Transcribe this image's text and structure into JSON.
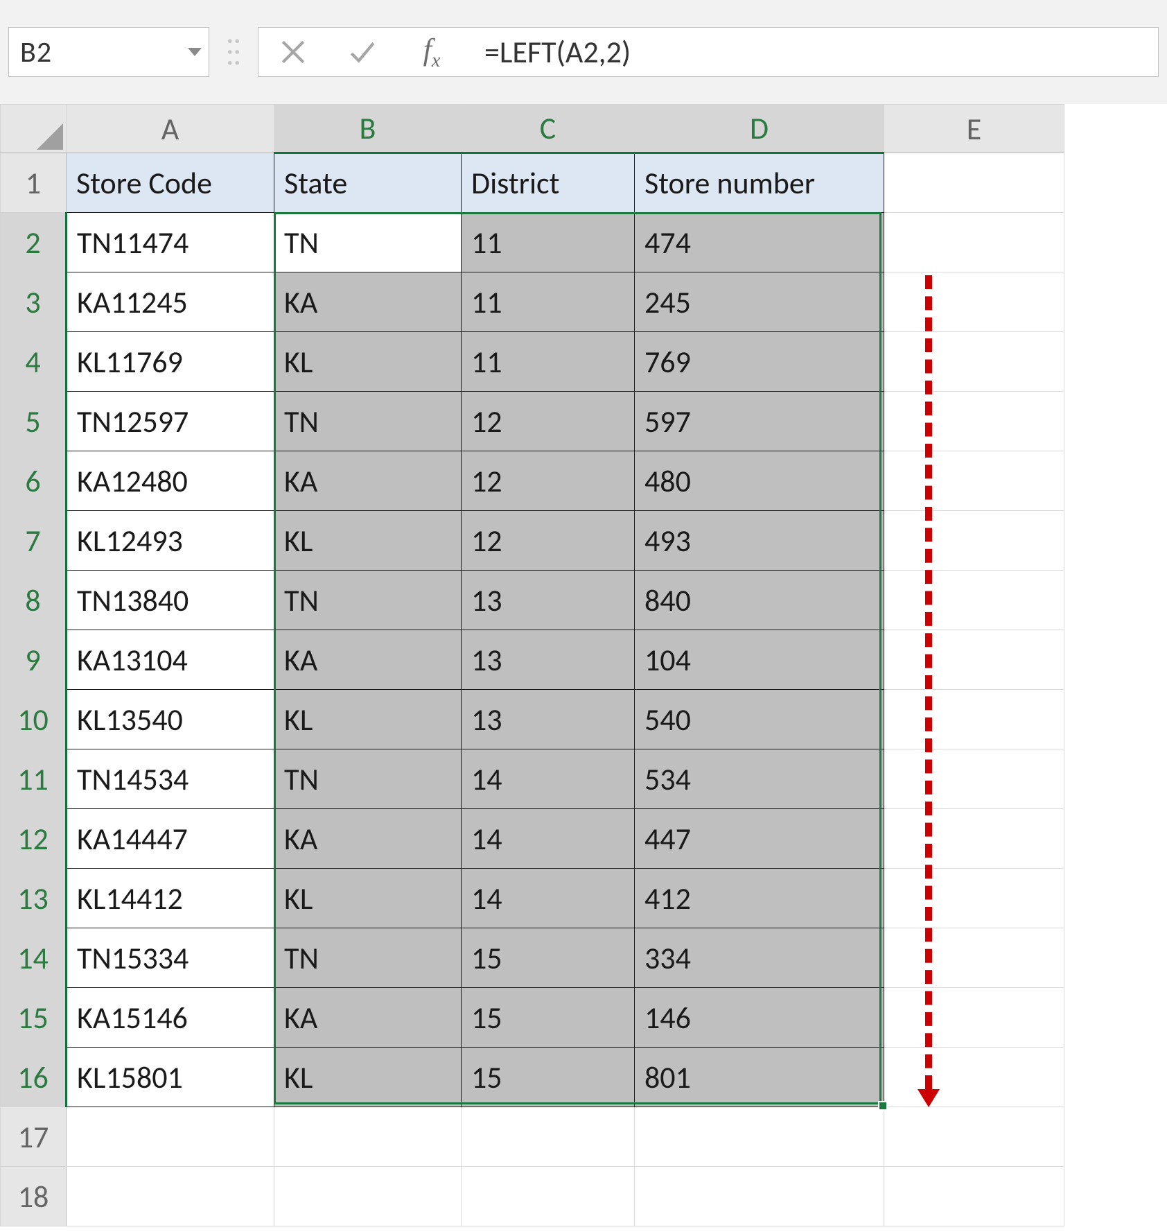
{
  "name_box": "B2",
  "formula": "=LEFT(A2,2)",
  "column_headers": [
    "A",
    "B",
    "C",
    "D",
    "E"
  ],
  "selected_columns": [
    "B",
    "C",
    "D"
  ],
  "visible_row_numbers": [
    1,
    2,
    3,
    4,
    5,
    6,
    7,
    8,
    9,
    10,
    11,
    12,
    13,
    14,
    15,
    16,
    17,
    18
  ],
  "selected_row_numbers": [
    2,
    3,
    4,
    5,
    6,
    7,
    8,
    9,
    10,
    11,
    12,
    13,
    14,
    15,
    16
  ],
  "active_cell": "B2",
  "headers": {
    "A": "Store Code",
    "B": "State",
    "C": "District",
    "D": "Store number"
  },
  "rows": [
    {
      "code": "TN11474",
      "state": "TN",
      "district": "11",
      "store": "474"
    },
    {
      "code": "KA11245",
      "state": "KA",
      "district": "11",
      "store": "245"
    },
    {
      "code": "KL11769",
      "state": "KL",
      "district": "11",
      "store": "769"
    },
    {
      "code": "TN12597",
      "state": "TN",
      "district": "12",
      "store": "597"
    },
    {
      "code": "KA12480",
      "state": "KA",
      "district": "12",
      "store": "480"
    },
    {
      "code": "KL12493",
      "state": "KL",
      "district": "12",
      "store": "493"
    },
    {
      "code": "TN13840",
      "state": "TN",
      "district": "13",
      "store": "840"
    },
    {
      "code": "KA13104",
      "state": "KA",
      "district": "13",
      "store": "104"
    },
    {
      "code": "KL13540",
      "state": "KL",
      "district": "13",
      "store": "540"
    },
    {
      "code": "TN14534",
      "state": "TN",
      "district": "14",
      "store": "534"
    },
    {
      "code": "KA14447",
      "state": "KA",
      "district": "14",
      "store": "447"
    },
    {
      "code": "KL14412",
      "state": "KL",
      "district": "14",
      "store": "412"
    },
    {
      "code": "TN15334",
      "state": "TN",
      "district": "15",
      "store": "334"
    },
    {
      "code": "KA15146",
      "state": "KA",
      "district": "15",
      "store": "146"
    },
    {
      "code": "KL15801",
      "state": "KL",
      "district": "15",
      "store": "801"
    }
  ],
  "icons": {
    "cancel": "cancel-icon",
    "enter": "enter-icon",
    "fx": "fx-icon",
    "namebox_dropdown": "chevron-down-icon",
    "selectall_triangle": "select-all-triangle"
  },
  "annotation": {
    "type": "dashed-arrow-down",
    "color": "#cc0000"
  }
}
